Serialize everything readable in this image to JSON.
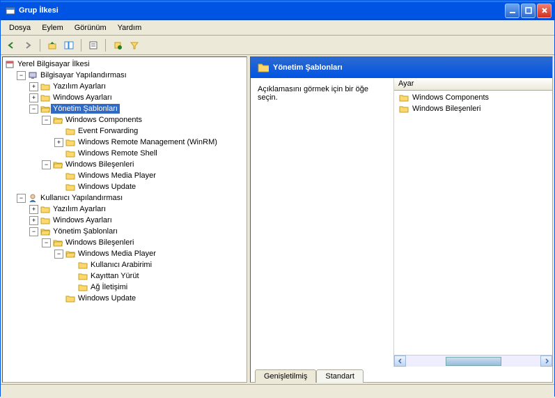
{
  "window": {
    "title": "Grup İlkesi"
  },
  "menu": {
    "dosya": "Dosya",
    "eylem": "Eylem",
    "gorunum": "Görünüm",
    "yardim": "Yardım"
  },
  "tree": {
    "root": "Yerel Bilgisayar İlkesi",
    "bilgisayar": "Bilgisayar Yapılandırması",
    "yazilim1": "Yazılım Ayarları",
    "windows1": "Windows Ayarları",
    "yonetim1": "Yönetim Şablonları",
    "wincomp": "Windows Components",
    "eventfwd": "Event Forwarding",
    "winrm": "Windows Remote Management (WinRM)",
    "winrs": "Windows Remote Shell",
    "winbiles1": "Windows Bileşenleri",
    "wmp1": "Windows Media Player",
    "winupdate1": "Windows Update",
    "kullanici": "Kullanıcı Yapılandırması",
    "yazilim2": "Yazılım Ayarları",
    "windows2": "Windows Ayarları",
    "yonetim2": "Yönetim Şablonları",
    "winbiles2": "Windows Bileşenleri",
    "wmp2": "Windows Media Player",
    "kullanici_ara": "Kullanıcı Arabirimi",
    "kayittan": "Kayıttan Yürüt",
    "ag": "Ağ İletişimi",
    "winupdate2": "Windows Update"
  },
  "panel": {
    "title": "Yönetim Şablonları",
    "desc": "Açıklamasını görmek için bir öğe seçin.",
    "col_header": "Ayar",
    "items": [
      "Windows Components",
      "Windows Bileşenleri"
    ]
  },
  "tabs": {
    "genisletilmis": "Genişletilmiş",
    "standart": "Standart"
  }
}
